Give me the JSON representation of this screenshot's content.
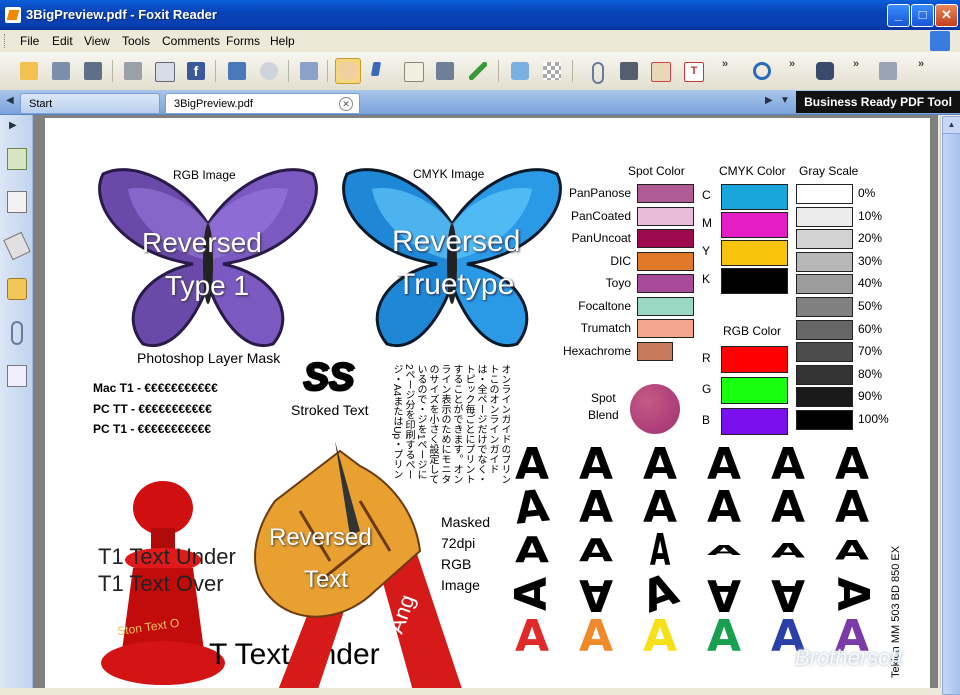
{
  "window": {
    "title": "3BigPreview.pdf - Foxit Reader",
    "minimize": "_",
    "maximize": "□",
    "close": "✕"
  },
  "menu": [
    "File",
    "Edit",
    "View",
    "Tools",
    "Comments",
    "Forms",
    "Help"
  ],
  "toolbar": {
    "icons": [
      "open-icon",
      "save-icon",
      "save-as-icon",
      "print-icon",
      "email-icon",
      "facebook-icon",
      "full-screen-icon",
      "find-icon",
      "snapshot-icon",
      "hand-tool-icon",
      "select-tool-icon",
      "select-text-icon",
      "snapshot-tool-icon",
      "typewriter-icon",
      "pencil-icon",
      "eraser-icon",
      "attach-icon",
      "fax-icon",
      "form-fill-icon",
      "text-box-icon",
      "rotate-icon",
      "binoculars-icon",
      "speaker-icon"
    ],
    "overflow": "»"
  },
  "tabs": {
    "start": "Start",
    "document": "3BigPreview.pdf",
    "close": "✕"
  },
  "brand_banner": "Business Ready PDF Tool",
  "nav_arrow": "▶",
  "scroll_up": "▲",
  "pdf": {
    "rgb_image_label": "RGB Image",
    "cmyk_image_label": "CMYK Image",
    "reversed_type1_line1": "Reversed",
    "reversed_type1_line2": "Type 1",
    "reversed_truetype_line1": "Reversed",
    "reversed_truetype_line2": "Truetype",
    "photoshop_mask": "Photoshop Layer Mask",
    "mac_t1": "Mac T1 - €€€€€€€€€€€",
    "pc_tt": "PC TT - €€€€€€€€€€€",
    "pc_t1": "PC T1 - €€€€€€€€€€€",
    "ss": "SS",
    "stroked_text": "Stroked Text",
    "japanese_text": "オンラインガイドのプリントこのオンラインガイドは・全ページだけでなく・トピック毎ごとにプリントすることができます。オンライン表示のためにモニタのサイズを小さく設定しているので・ジを1ページに2ページ分を印刷するページ・A4またはUp・プリントしたほうがよい場合があります",
    "reversed_text_line1": "Reversed",
    "reversed_text_line2": "Text",
    "masked": [
      "Masked",
      "72dpi",
      "RGB",
      "Image"
    ],
    "t1_under": "T1 Text Under",
    "t1_over": "T1 Text Over",
    "pawn_text": "Ston Text O",
    "tt_under": "T Text Under",
    "ribbon_text": "Ang",
    "spot_blend": [
      "Spot",
      "Blend"
    ],
    "vertical_label": "Teklon MM 503 BD 850 EX"
  },
  "spot_colors": {
    "title": "Spot Color",
    "items": [
      {
        "name": "PanPanose",
        "color": "#b05a96"
      },
      {
        "name": "PanCoated",
        "color": "#e8bcd8"
      },
      {
        "name": "PanUncoat",
        "color": "#9e0a4e"
      },
      {
        "name": "DIC",
        "color": "#e07a28"
      },
      {
        "name": "Toyo",
        "color": "#a84a9a"
      },
      {
        "name": "Focaltone",
        "color": "#9ad8c4"
      },
      {
        "name": "Trumatch",
        "color": "#f4a590"
      },
      {
        "name": "Hexachrome",
        "color": "#c87a5c"
      }
    ]
  },
  "cmyk_colors": {
    "title": "CMYK Color",
    "items": [
      {
        "name": "C",
        "color": "#18a6dc"
      },
      {
        "name": "M",
        "color": "#e21ec4"
      },
      {
        "name": "Y",
        "color": "#f7c50b"
      },
      {
        "name": "K",
        "color": "#000000"
      }
    ]
  },
  "rgb_colors": {
    "title": "RGB Color",
    "items": [
      {
        "name": "R",
        "color": "#ff0000"
      },
      {
        "name": "G",
        "color": "#19ff10"
      },
      {
        "name": "B",
        "color": "#7a10ee"
      }
    ]
  },
  "gray_scale": {
    "title": "Gray Scale",
    "items": [
      {
        "name": "0%",
        "color": "#ffffff"
      },
      {
        "name": "10%",
        "color": "#ececec"
      },
      {
        "name": "20%",
        "color": "#d2d2d2"
      },
      {
        "name": "30%",
        "color": "#b7b7b7"
      },
      {
        "name": "40%",
        "color": "#9c9c9c"
      },
      {
        "name": "50%",
        "color": "#808080"
      },
      {
        "name": "60%",
        "color": "#666666"
      },
      {
        "name": "70%",
        "color": "#4c4c4c"
      },
      {
        "name": "80%",
        "color": "#333333"
      },
      {
        "name": "90%",
        "color": "#1a1a1a"
      },
      {
        "name": "100%",
        "color": "#000000"
      }
    ]
  },
  "letter_grid": {
    "glyph": "A",
    "row_colors": [
      "#000000",
      "#000000",
      "#000000",
      "#000000",
      "#000000"
    ],
    "last_row_colors": [
      "#e02a2a",
      "#f08a28",
      "#f5e01a",
      "#18a050",
      "#2a40a8",
      "#7a3aa8"
    ]
  },
  "watermark": "Brothersoft"
}
